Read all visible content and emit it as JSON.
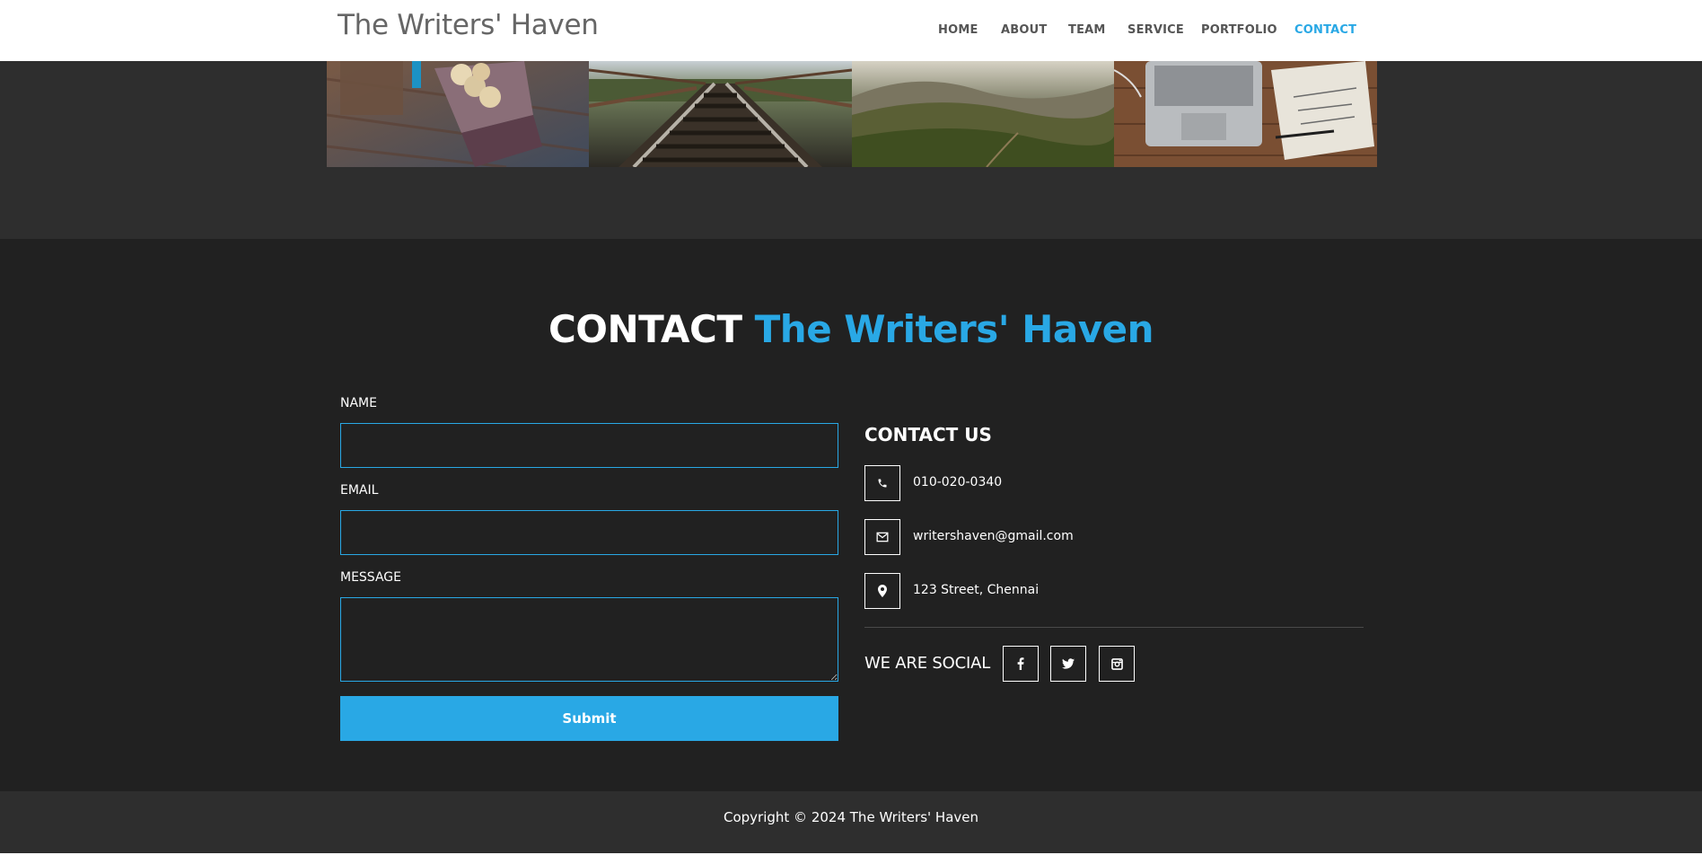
{
  "header": {
    "brand": "The Writers' Haven",
    "nav": [
      {
        "label": "HOME",
        "active": false
      },
      {
        "label": "ABOUT",
        "active": false
      },
      {
        "label": "TEAM",
        "active": false
      },
      {
        "label": "SERVICE",
        "active": false
      },
      {
        "label": "PORTFOLIO",
        "active": false
      },
      {
        "label": "CONTACT",
        "active": true
      }
    ]
  },
  "portfolio": {
    "photos": [
      "coffee-macarons-photo",
      "railway-bridge-photo",
      "mountain-landscape-photo",
      "laptop-notebook-photo"
    ]
  },
  "contact": {
    "title_plain": "CONTACT",
    "title_accent": "The Writers' Haven",
    "form": {
      "name_label": "NAME",
      "name_value": "",
      "email_label": "EMAIL",
      "email_value": "",
      "message_label": "MESSAGE",
      "message_value": "",
      "submit_label": "Submit"
    },
    "info": {
      "heading": "CONTACT US",
      "phone": "010-020-0340",
      "email": "writershaven@gmail.com",
      "address": "123 Street, Chennai"
    },
    "social": {
      "label": "WE ARE SOCIAL",
      "icons": [
        "facebook-icon",
        "twitter-icon",
        "instagram-icon"
      ]
    }
  },
  "footer": {
    "copyright": "Copyright © 2024 The Writers' Haven"
  },
  "colors": {
    "accent": "#29a8e5",
    "section_bg": "#212121",
    "band_bg": "#2e2e2e"
  }
}
